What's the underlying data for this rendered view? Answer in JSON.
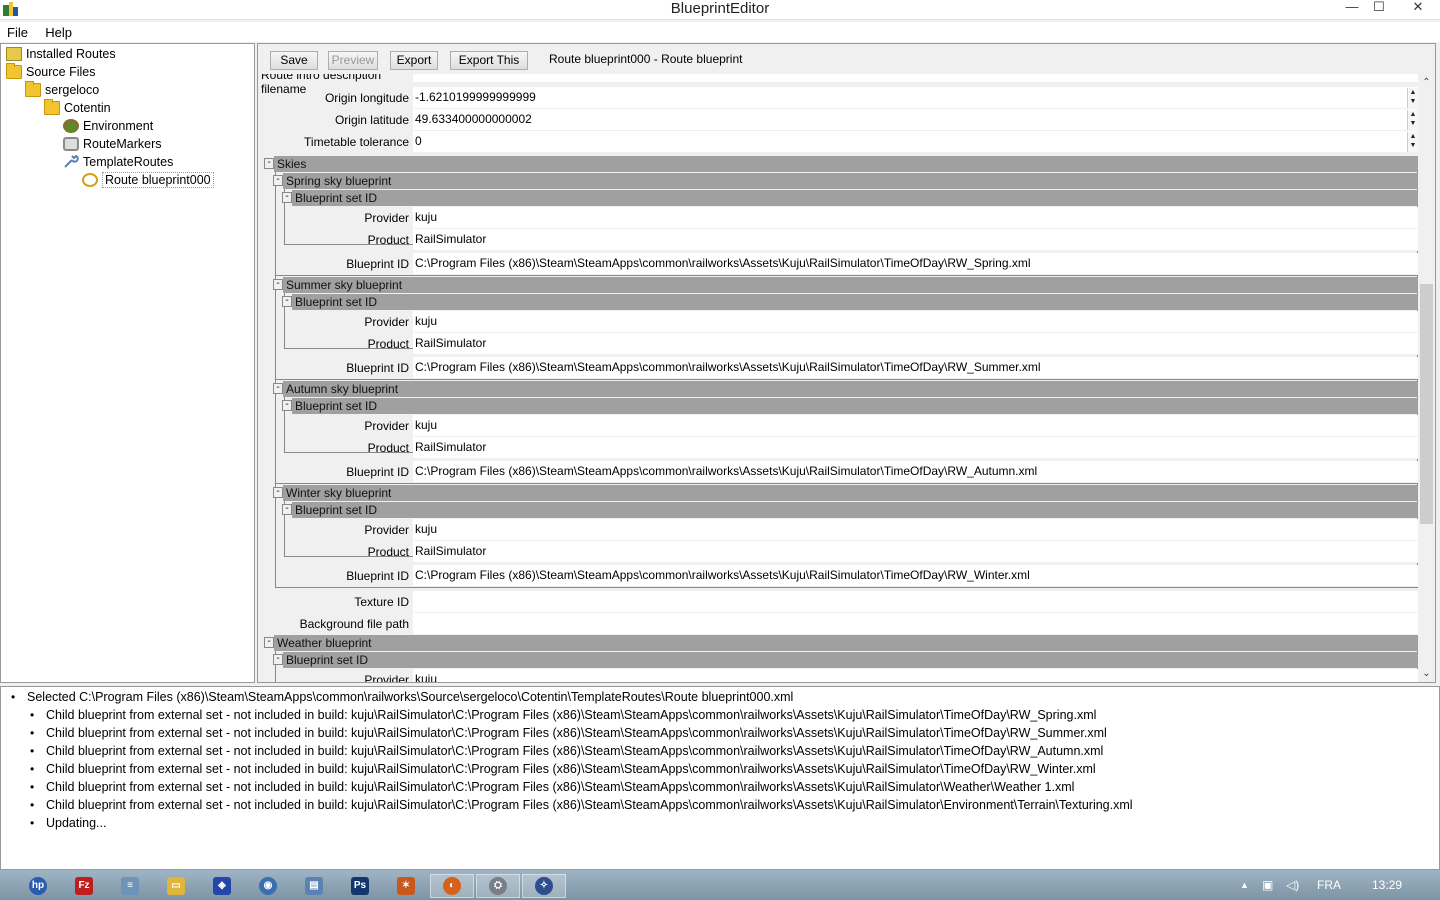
{
  "window": {
    "title": "BlueprintEditor",
    "minimize": "—",
    "maximize": "☐",
    "close": "✕"
  },
  "menu": [
    "File",
    "Help"
  ],
  "tree": [
    {
      "label": "Installed Routes",
      "icon": "installed-routes-icon",
      "level": 0
    },
    {
      "label": "Source Files",
      "icon": "folder-icon",
      "level": 0
    },
    {
      "label": "sergeloco",
      "icon": "folder-icon",
      "level": 1
    },
    {
      "label": "Cotentin",
      "icon": "folder-icon",
      "level": 2
    },
    {
      "label": "Environment",
      "icon": "environment-icon",
      "level": 3
    },
    {
      "label": "RouteMarkers",
      "icon": "route-markers-icon",
      "level": 3
    },
    {
      "label": "TemplateRoutes",
      "icon": "wrench-icon",
      "level": 3
    },
    {
      "label": "Route blueprint000",
      "icon": "blueprint-icon",
      "level": 4,
      "selected": true
    }
  ],
  "toolbar": {
    "save": "Save",
    "preview": "Preview",
    "export": "Export",
    "export_this": "Export This",
    "crumb": "Route blueprint000 - Route blueprint"
  },
  "props": {
    "intro_label": "Route intro description filename",
    "origin_longitude": {
      "label": "Origin longitude",
      "value": "-1.6210199999999999"
    },
    "origin_latitude": {
      "label": "Origin latitude",
      "value": "49.633400000000002"
    },
    "timetable_tolerance": {
      "label": "Timetable tolerance",
      "value": "0"
    },
    "skies_header": "Skies",
    "blueprint_set_id": "Blueprint set ID",
    "provider_label": "Provider",
    "product_label": "Product",
    "blueprint_id_label": "Blueprint ID",
    "seasons": [
      {
        "header": "Spring sky blueprint",
        "provider": "kuju",
        "product": "RailSimulator",
        "blueprint_id": "C:\\Program Files (x86)\\Steam\\SteamApps\\common\\railworks\\Assets\\Kuju\\RailSimulator\\TimeOfDay\\RW_Spring.xml"
      },
      {
        "header": "Summer sky blueprint",
        "provider": "kuju",
        "product": "RailSimulator",
        "blueprint_id": "C:\\Program Files (x86)\\Steam\\SteamApps\\common\\railworks\\Assets\\Kuju\\RailSimulator\\TimeOfDay\\RW_Summer.xml"
      },
      {
        "header": "Autumn sky blueprint",
        "provider": "kuju",
        "product": "RailSimulator",
        "blueprint_id": "C:\\Program Files (x86)\\Steam\\SteamApps\\common\\railworks\\Assets\\Kuju\\RailSimulator\\TimeOfDay\\RW_Autumn.xml"
      },
      {
        "header": "Winter sky blueprint",
        "provider": "kuju",
        "product": "RailSimulator",
        "blueprint_id": "C:\\Program Files (x86)\\Steam\\SteamApps\\common\\railworks\\Assets\\Kuju\\RailSimulator\\TimeOfDay\\RW_Winter.xml"
      }
    ],
    "texture_id": {
      "label": "Texture ID",
      "value": ""
    },
    "background_file_path": {
      "label": "Background file path",
      "value": ""
    },
    "weather_header": "Weather blueprint",
    "weather_provider": "kuju"
  },
  "log": {
    "selected": "Selected C:\\Program Files (x86)\\Steam\\SteamApps\\common\\railworks\\Source\\sergeloco\\Cotentin\\TemplateRoutes\\Route blueprint000.xml",
    "children": [
      "Child blueprint from external set - not included in build: kuju\\RailSimulator\\C:\\Program Files (x86)\\Steam\\SteamApps\\common\\railworks\\Assets\\Kuju\\RailSimulator\\TimeOfDay\\RW_Spring.xml",
      "Child blueprint from external set - not included in build: kuju\\RailSimulator\\C:\\Program Files (x86)\\Steam\\SteamApps\\common\\railworks\\Assets\\Kuju\\RailSimulator\\TimeOfDay\\RW_Summer.xml",
      "Child blueprint from external set - not included in build: kuju\\RailSimulator\\C:\\Program Files (x86)\\Steam\\SteamApps\\common\\railworks\\Assets\\Kuju\\RailSimulator\\TimeOfDay\\RW_Autumn.xml",
      "Child blueprint from external set - not included in build: kuju\\RailSimulator\\C:\\Program Files (x86)\\Steam\\SteamApps\\common\\railworks\\Assets\\Kuju\\RailSimulator\\TimeOfDay\\RW_Winter.xml",
      "Child blueprint from external set - not included in build: kuju\\RailSimulator\\C:\\Program Files (x86)\\Steam\\SteamApps\\common\\railworks\\Assets\\Kuju\\RailSimulator\\Weather\\Weather 1.xml",
      "Child blueprint from external set - not included in build: kuju\\RailSimulator\\C:\\Program Files (x86)\\Steam\\SteamApps\\common\\railworks\\Assets\\Kuju\\RailSimulator\\Environment\\Terrain\\Texturing.xml",
      "Updating..."
    ]
  },
  "taskbar": {
    "apps": [
      {
        "name": "hp-icon",
        "color": "#2a5db0",
        "glyph": "hp"
      },
      {
        "name": "filezilla-icon",
        "color": "#bf1e1e",
        "glyph": "Fz"
      },
      {
        "name": "notepad-icon",
        "color": "#6e93b8",
        "glyph": "≡"
      },
      {
        "name": "file-explorer-icon",
        "color": "#e1b53a",
        "glyph": "▭"
      },
      {
        "name": "app-blue-icon",
        "color": "#2446a8",
        "glyph": "◈"
      },
      {
        "name": "network-globe-icon",
        "color": "#3a6fb0",
        "glyph": "◉"
      },
      {
        "name": "document-icon",
        "color": "#5b82b4",
        "glyph": "▤"
      },
      {
        "name": "photoshop-icon",
        "color": "#13376b",
        "glyph": "Ps"
      },
      {
        "name": "tool-orange-icon",
        "color": "#c9581c",
        "glyph": "✶"
      },
      {
        "name": "firefox-icon",
        "color": "#d5621a",
        "glyph": "◐"
      },
      {
        "name": "railworks-icon",
        "color": "#7a7f86",
        "glyph": "⛭"
      },
      {
        "name": "blueprint-editor-icon",
        "color": "#2e4f8f",
        "glyph": "✧"
      }
    ],
    "tray_arrow": "▲",
    "language": "FRA",
    "time": "13:29"
  }
}
